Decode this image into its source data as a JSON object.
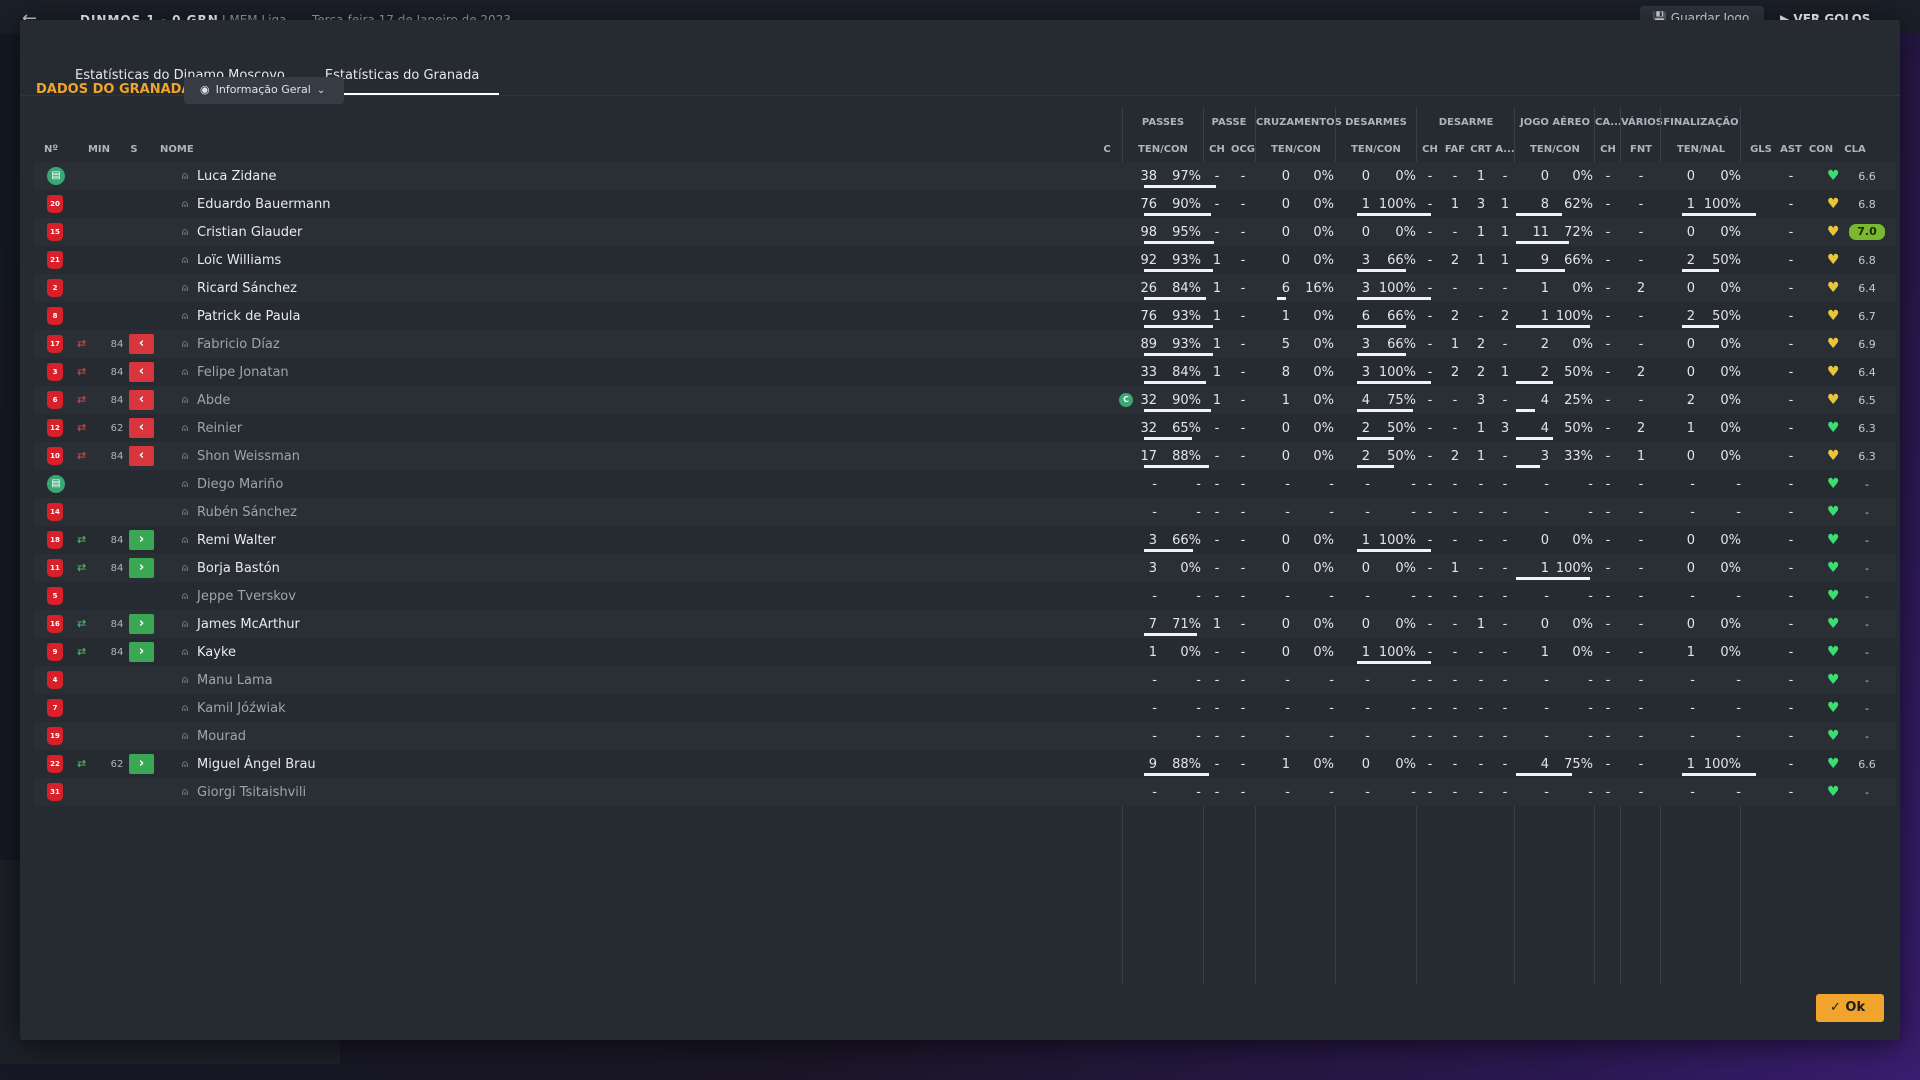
{
  "background": {
    "score": "DINMOS  1 - 0  GRN",
    "league": "I MEM Liga",
    "date": "Terça-feira 17 de Janeiro de 2023",
    "save_label": "Guardar Jogo",
    "goals_label": "VER GOLOS"
  },
  "tabs": [
    {
      "label": "Estatísticas do Dinamo Moscovo",
      "active": false
    },
    {
      "label": "Estatísticas do Granada",
      "active": true
    }
  ],
  "section_title": "DADOS DO GRANADA",
  "view_dropdown": {
    "value": "Informação Geral"
  },
  "group_headers": {
    "passes": "PASSES",
    "passe": "PASSE",
    "cruzamentos": "CRUZAMENTOS",
    "desarmes": "DESARMES",
    "desarme": "DESARME",
    "jogo_aereo": "JOGO AÉREO",
    "ca": "CA...",
    "varios": "VÁRIOS",
    "finalizacao": "FINALIZAÇÃO"
  },
  "columns": {
    "num": "Nº",
    "min": "MIN",
    "s": "S",
    "nome": "NOME",
    "c": "C",
    "passes_tc": "TEN/CON",
    "passe_ch": "CH",
    "passe_ocg": "OCG",
    "cruz_tc": "TEN/CON",
    "desarmes_tc": "TEN/CON",
    "des_ch": "CH",
    "des_faf": "FAF",
    "des_crt": "CRT",
    "des_a": "A...",
    "aereo_tc": "TEN/CON",
    "ca_ch": "CH",
    "fnt": "FNT",
    "fin_tn": "TEN/NAL",
    "gls": "GLS",
    "ast": "AST",
    "con": "CON",
    "cla": "CLA"
  },
  "colors": {
    "accent": "#f0a42b",
    "shirt": "#d8202a",
    "gk_shirt": "#3aa873",
    "sub_out": "#d8363c",
    "sub_in": "#3aa853",
    "heart_green": "#3ddc6e",
    "heart_yellow": "#e8c53a",
    "best_rating": "#7ab82d"
  },
  "players": [
    {
      "num": "",
      "gk": true,
      "sub": "",
      "min": "",
      "name": "Luca Zidane",
      "cap": false,
      "pt": "38",
      "pp": "97%",
      "pch": "-",
      "ocg": "-",
      "ct": "0",
      "cp": "0%",
      "dt": "0",
      "dp": "0%",
      "dch": "-",
      "faf": "-",
      "crt": "1",
      "da": "-",
      "at": "0",
      "ap": "0%",
      "cach": "-",
      "fnt": "-",
      "ft": "0",
      "fp": "0%",
      "gls": "",
      "ast": "-",
      "heart": "green",
      "cla": "6.6",
      "best": false,
      "dim": false
    },
    {
      "num": "20",
      "gk": false,
      "sub": "",
      "min": "",
      "name": "Eduardo Bauermann",
      "cap": false,
      "pt": "76",
      "pp": "90%",
      "pch": "-",
      "ocg": "-",
      "ct": "0",
      "cp": "0%",
      "dt": "1",
      "dp": "100%",
      "dch": "-",
      "faf": "1",
      "crt": "3",
      "da": "1",
      "at": "8",
      "ap": "62%",
      "cach": "-",
      "fnt": "-",
      "ft": "1",
      "fp": "100%",
      "gls": "",
      "ast": "-",
      "heart": "yellow",
      "cla": "6.8",
      "best": false,
      "dim": false
    },
    {
      "num": "15",
      "gk": false,
      "sub": "",
      "min": "",
      "name": "Cristian Glauder",
      "cap": false,
      "pt": "98",
      "pp": "95%",
      "pch": "-",
      "ocg": "-",
      "ct": "0",
      "cp": "0%",
      "dt": "0",
      "dp": "0%",
      "dch": "-",
      "faf": "-",
      "crt": "1",
      "da": "1",
      "at": "11",
      "ap": "72%",
      "cach": "-",
      "fnt": "-",
      "ft": "0",
      "fp": "0%",
      "gls": "",
      "ast": "-",
      "heart": "yellow",
      "cla": "7.0",
      "best": true,
      "dim": false
    },
    {
      "num": "21",
      "gk": false,
      "sub": "",
      "min": "",
      "name": "Loïc Williams",
      "cap": false,
      "pt": "92",
      "pp": "93%",
      "pch": "1",
      "ocg": "-",
      "ct": "0",
      "cp": "0%",
      "dt": "3",
      "dp": "66%",
      "dch": "-",
      "faf": "2",
      "crt": "1",
      "da": "1",
      "at": "9",
      "ap": "66%",
      "cach": "-",
      "fnt": "-",
      "ft": "2",
      "fp": "50%",
      "gls": "",
      "ast": "-",
      "heart": "yellow",
      "cla": "6.8",
      "best": false,
      "dim": false
    },
    {
      "num": "2",
      "gk": false,
      "sub": "",
      "min": "",
      "name": "Ricard Sánchez",
      "cap": false,
      "pt": "26",
      "pp": "84%",
      "pch": "1",
      "ocg": "-",
      "ct": "6",
      "cp": "16%",
      "dt": "3",
      "dp": "100%",
      "dch": "-",
      "faf": "-",
      "crt": "-",
      "da": "-",
      "at": "1",
      "ap": "0%",
      "cach": "-",
      "fnt": "2",
      "ft": "0",
      "fp": "0%",
      "gls": "",
      "ast": "-",
      "heart": "yellow",
      "cla": "6.4",
      "best": false,
      "dim": false
    },
    {
      "num": "8",
      "gk": false,
      "sub": "",
      "min": "",
      "name": "Patrick de Paula",
      "cap": false,
      "pt": "76",
      "pp": "93%",
      "pch": "1",
      "ocg": "-",
      "ct": "1",
      "cp": "0%",
      "dt": "6",
      "dp": "66%",
      "dch": "-",
      "faf": "2",
      "crt": "-",
      "da": "2",
      "at": "1",
      "ap": "100%",
      "cach": "-",
      "fnt": "-",
      "ft": "2",
      "fp": "50%",
      "gls": "",
      "ast": "-",
      "heart": "yellow",
      "cla": "6.7",
      "best": false,
      "dim": false
    },
    {
      "num": "17",
      "gk": false,
      "sub": "out",
      "min": "84",
      "name": "Fabricio Díaz",
      "cap": false,
      "pt": "89",
      "pp": "93%",
      "pch": "1",
      "ocg": "-",
      "ct": "5",
      "cp": "0%",
      "dt": "3",
      "dp": "66%",
      "dch": "-",
      "faf": "1",
      "crt": "2",
      "da": "-",
      "at": "2",
      "ap": "0%",
      "cach": "-",
      "fnt": "-",
      "ft": "0",
      "fp": "0%",
      "gls": "",
      "ast": "-",
      "heart": "yellow",
      "cla": "6.9",
      "best": false,
      "dim": true
    },
    {
      "num": "3",
      "gk": false,
      "sub": "out",
      "min": "84",
      "name": "Felipe Jonatan",
      "cap": false,
      "pt": "33",
      "pp": "84%",
      "pch": "1",
      "ocg": "-",
      "ct": "8",
      "cp": "0%",
      "dt": "3",
      "dp": "100%",
      "dch": "-",
      "faf": "2",
      "crt": "2",
      "da": "1",
      "at": "2",
      "ap": "50%",
      "cach": "-",
      "fnt": "2",
      "ft": "0",
      "fp": "0%",
      "gls": "",
      "ast": "-",
      "heart": "yellow",
      "cla": "6.4",
      "best": false,
      "dim": true
    },
    {
      "num": "6",
      "gk": false,
      "sub": "out",
      "min": "84",
      "name": "Abde",
      "cap": true,
      "pt": "32",
      "pp": "90%",
      "pch": "1",
      "ocg": "-",
      "ct": "1",
      "cp": "0%",
      "dt": "4",
      "dp": "75%",
      "dch": "-",
      "faf": "-",
      "crt": "3",
      "da": "-",
      "at": "4",
      "ap": "25%",
      "cach": "-",
      "fnt": "-",
      "ft": "2",
      "fp": "0%",
      "gls": "",
      "ast": "-",
      "heart": "yellow",
      "cla": "6.5",
      "best": false,
      "dim": true
    },
    {
      "num": "12",
      "gk": false,
      "sub": "out",
      "min": "62",
      "name": "Reinier",
      "cap": false,
      "pt": "32",
      "pp": "65%",
      "pch": "-",
      "ocg": "-",
      "ct": "0",
      "cp": "0%",
      "dt": "2",
      "dp": "50%",
      "dch": "-",
      "faf": "-",
      "crt": "1",
      "da": "3",
      "at": "4",
      "ap": "50%",
      "cach": "-",
      "fnt": "2",
      "ft": "1",
      "fp": "0%",
      "gls": "",
      "ast": "-",
      "heart": "green",
      "cla": "6.3",
      "best": false,
      "dim": true
    },
    {
      "num": "10",
      "gk": false,
      "sub": "out",
      "min": "84",
      "name": "Shon Weissman",
      "cap": false,
      "pt": "17",
      "pp": "88%",
      "pch": "-",
      "ocg": "-",
      "ct": "0",
      "cp": "0%",
      "dt": "2",
      "dp": "50%",
      "dch": "-",
      "faf": "2",
      "crt": "1",
      "da": "-",
      "at": "3",
      "ap": "33%",
      "cach": "-",
      "fnt": "1",
      "ft": "0",
      "fp": "0%",
      "gls": "",
      "ast": "-",
      "heart": "yellow",
      "cla": "6.3",
      "best": false,
      "dim": true
    },
    {
      "num": "",
      "gk": true,
      "sub": "",
      "min": "",
      "name": "Diego Mariño",
      "cap": false,
      "pt": "-",
      "pp": "-",
      "pch": "-",
      "ocg": "-",
      "ct": "-",
      "cp": "-",
      "dt": "-",
      "dp": "-",
      "dch": "-",
      "faf": "-",
      "crt": "-",
      "da": "-",
      "at": "-",
      "ap": "-",
      "cach": "-",
      "fnt": "-",
      "ft": "-",
      "fp": "-",
      "gls": "",
      "ast": "-",
      "heart": "green",
      "cla": "-",
      "best": false,
      "dim": true
    },
    {
      "num": "14",
      "gk": false,
      "sub": "",
      "min": "",
      "name": "Rubén Sánchez",
      "cap": false,
      "pt": "-",
      "pp": "-",
      "pch": "-",
      "ocg": "-",
      "ct": "-",
      "cp": "-",
      "dt": "-",
      "dp": "-",
      "dch": "-",
      "faf": "-",
      "crt": "-",
      "da": "-",
      "at": "-",
      "ap": "-",
      "cach": "-",
      "fnt": "-",
      "ft": "-",
      "fp": "-",
      "gls": "",
      "ast": "-",
      "heart": "green",
      "cla": "-",
      "best": false,
      "dim": true
    },
    {
      "num": "18",
      "gk": false,
      "sub": "in",
      "min": "84",
      "name": "Remi Walter",
      "cap": false,
      "pt": "3",
      "pp": "66%",
      "pch": "-",
      "ocg": "-",
      "ct": "0",
      "cp": "0%",
      "dt": "1",
      "dp": "100%",
      "dch": "-",
      "faf": "-",
      "crt": "-",
      "da": "-",
      "at": "0",
      "ap": "0%",
      "cach": "-",
      "fnt": "-",
      "ft": "0",
      "fp": "0%",
      "gls": "",
      "ast": "-",
      "heart": "green",
      "cla": "-",
      "best": false,
      "dim": false
    },
    {
      "num": "11",
      "gk": false,
      "sub": "in",
      "min": "84",
      "name": "Borja Bastón",
      "cap": false,
      "pt": "3",
      "pp": "0%",
      "pch": "-",
      "ocg": "-",
      "ct": "0",
      "cp": "0%",
      "dt": "0",
      "dp": "0%",
      "dch": "-",
      "faf": "1",
      "crt": "-",
      "da": "-",
      "at": "1",
      "ap": "100%",
      "cach": "-",
      "fnt": "-",
      "ft": "0",
      "fp": "0%",
      "gls": "",
      "ast": "-",
      "heart": "green",
      "cla": "-",
      "best": false,
      "dim": false
    },
    {
      "num": "5",
      "gk": false,
      "sub": "",
      "min": "",
      "name": "Jeppe Tverskov",
      "cap": false,
      "pt": "-",
      "pp": "-",
      "pch": "-",
      "ocg": "-",
      "ct": "-",
      "cp": "-",
      "dt": "-",
      "dp": "-",
      "dch": "-",
      "faf": "-",
      "crt": "-",
      "da": "-",
      "at": "-",
      "ap": "-",
      "cach": "-",
      "fnt": "-",
      "ft": "-",
      "fp": "-",
      "gls": "",
      "ast": "-",
      "heart": "green",
      "cla": "-",
      "best": false,
      "dim": true
    },
    {
      "num": "16",
      "gk": false,
      "sub": "in",
      "min": "84",
      "name": "James McArthur",
      "cap": false,
      "pt": "7",
      "pp": "71%",
      "pch": "1",
      "ocg": "-",
      "ct": "0",
      "cp": "0%",
      "dt": "0",
      "dp": "0%",
      "dch": "-",
      "faf": "-",
      "crt": "1",
      "da": "-",
      "at": "0",
      "ap": "0%",
      "cach": "-",
      "fnt": "-",
      "ft": "0",
      "fp": "0%",
      "gls": "",
      "ast": "-",
      "heart": "green",
      "cla": "-",
      "best": false,
      "dim": false
    },
    {
      "num": "9",
      "gk": false,
      "sub": "in",
      "min": "84",
      "name": "Kayke",
      "cap": false,
      "pt": "1",
      "pp": "0%",
      "pch": "-",
      "ocg": "-",
      "ct": "0",
      "cp": "0%",
      "dt": "1",
      "dp": "100%",
      "dch": "-",
      "faf": "-",
      "crt": "-",
      "da": "-",
      "at": "1",
      "ap": "0%",
      "cach": "-",
      "fnt": "-",
      "ft": "1",
      "fp": "0%",
      "gls": "",
      "ast": "-",
      "heart": "green",
      "cla": "-",
      "best": false,
      "dim": false
    },
    {
      "num": "4",
      "gk": false,
      "sub": "",
      "min": "",
      "name": "Manu Lama",
      "cap": false,
      "pt": "-",
      "pp": "-",
      "pch": "-",
      "ocg": "-",
      "ct": "-",
      "cp": "-",
      "dt": "-",
      "dp": "-",
      "dch": "-",
      "faf": "-",
      "crt": "-",
      "da": "-",
      "at": "-",
      "ap": "-",
      "cach": "-",
      "fnt": "-",
      "ft": "-",
      "fp": "-",
      "gls": "",
      "ast": "-",
      "heart": "green",
      "cla": "-",
      "best": false,
      "dim": true
    },
    {
      "num": "7",
      "gk": false,
      "sub": "",
      "min": "",
      "name": "Kamil Jóźwiak",
      "cap": false,
      "pt": "-",
      "pp": "-",
      "pch": "-",
      "ocg": "-",
      "ct": "-",
      "cp": "-",
      "dt": "-",
      "dp": "-",
      "dch": "-",
      "faf": "-",
      "crt": "-",
      "da": "-",
      "at": "-",
      "ap": "-",
      "cach": "-",
      "fnt": "-",
      "ft": "-",
      "fp": "-",
      "gls": "",
      "ast": "-",
      "heart": "green",
      "cla": "-",
      "best": false,
      "dim": true
    },
    {
      "num": "19",
      "gk": false,
      "sub": "",
      "min": "",
      "name": "Mourad",
      "cap": false,
      "pt": "-",
      "pp": "-",
      "pch": "-",
      "ocg": "-",
      "ct": "-",
      "cp": "-",
      "dt": "-",
      "dp": "-",
      "dch": "-",
      "faf": "-",
      "crt": "-",
      "da": "-",
      "at": "-",
      "ap": "-",
      "cach": "-",
      "fnt": "-",
      "ft": "-",
      "fp": "-",
      "gls": "",
      "ast": "-",
      "heart": "green",
      "cla": "-",
      "best": false,
      "dim": true
    },
    {
      "num": "22",
      "gk": false,
      "sub": "in",
      "min": "62",
      "name": "Miguel Ángel Brau",
      "cap": false,
      "pt": "9",
      "pp": "88%",
      "pch": "-",
      "ocg": "-",
      "ct": "1",
      "cp": "0%",
      "dt": "0",
      "dp": "0%",
      "dch": "-",
      "faf": "-",
      "crt": "-",
      "da": "-",
      "at": "4",
      "ap": "75%",
      "cach": "-",
      "fnt": "-",
      "ft": "1",
      "fp": "100%",
      "gls": "",
      "ast": "-",
      "heart": "green",
      "cla": "6.6",
      "best": false,
      "dim": false
    },
    {
      "num": "31",
      "gk": false,
      "sub": "",
      "min": "",
      "name": "Giorgi Tsitaishvili",
      "cap": false,
      "pt": "-",
      "pp": "-",
      "pch": "-",
      "ocg": "-",
      "ct": "-",
      "cp": "-",
      "dt": "-",
      "dp": "-",
      "dch": "-",
      "faf": "-",
      "crt": "-",
      "da": "-",
      "at": "-",
      "ap": "-",
      "cach": "-",
      "fnt": "-",
      "ft": "-",
      "fp": "-",
      "gls": "",
      "ast": "-",
      "heart": "green",
      "cla": "-",
      "best": false,
      "dim": true
    }
  ],
  "ok_label": "Ok"
}
